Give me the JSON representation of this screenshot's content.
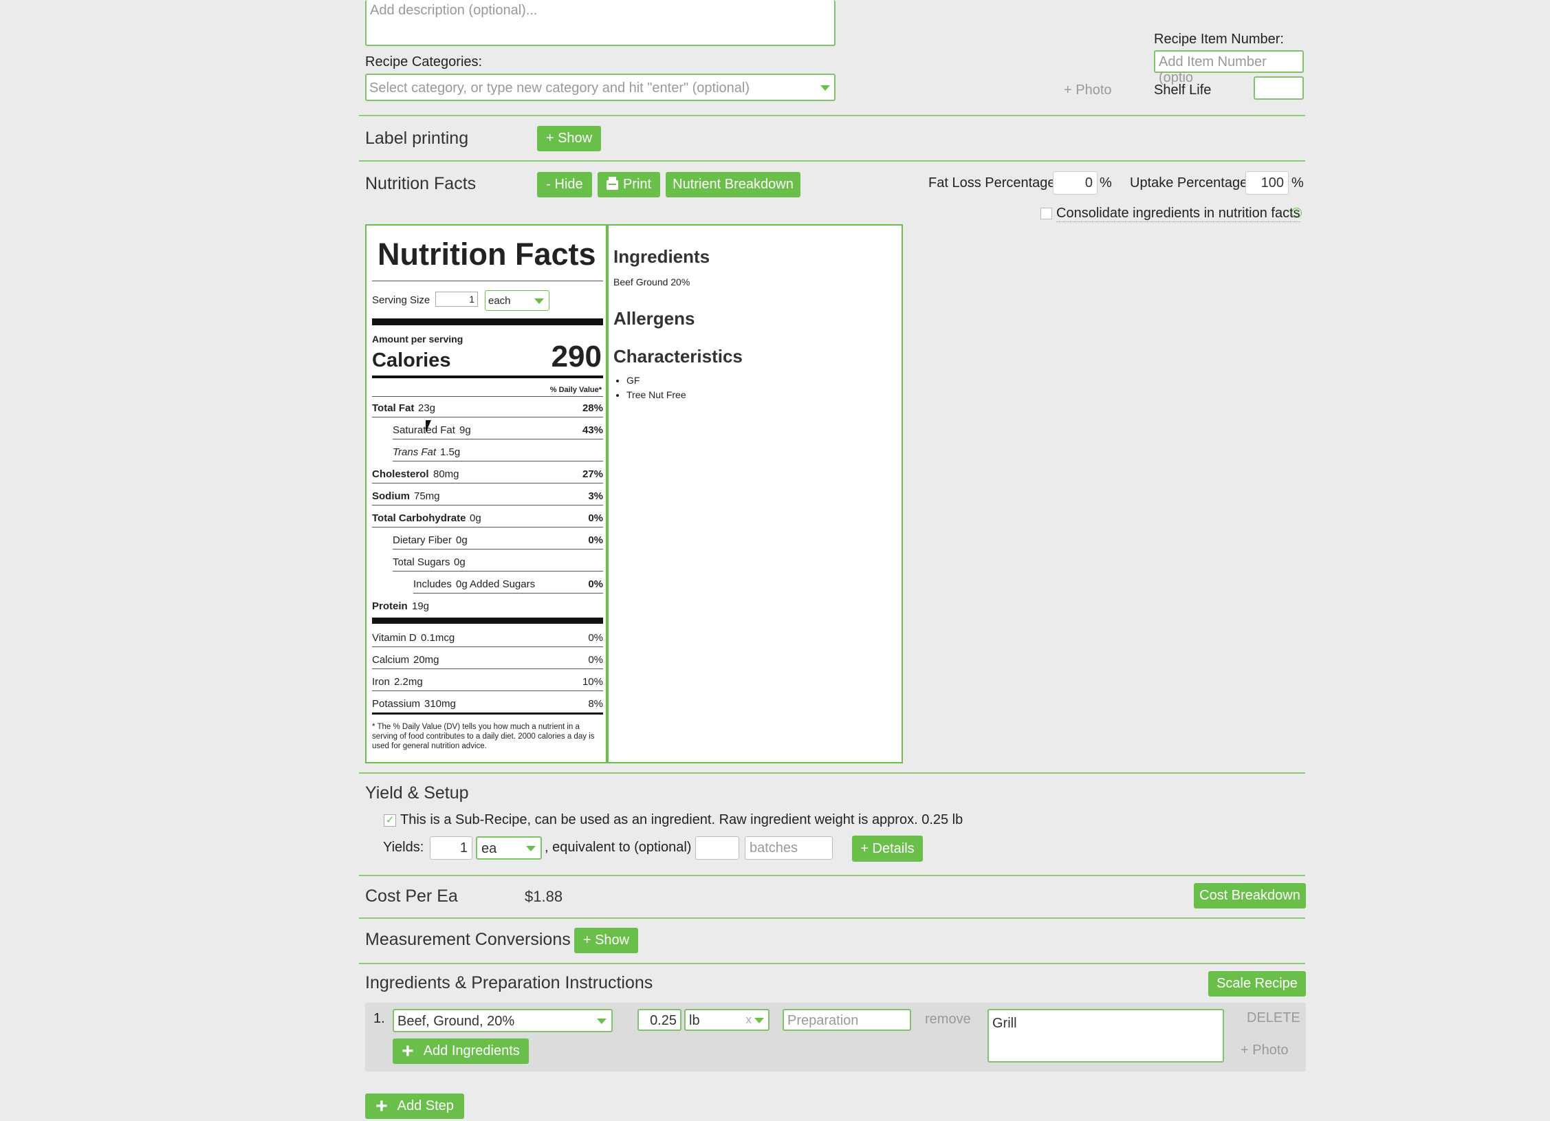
{
  "description": {
    "placeholder": "Add description (optional)..."
  },
  "categories": {
    "label": "Recipe Categories:",
    "placeholder": "Select category, or type new category and hit \"enter\" (optional)"
  },
  "photo_label": "+ Photo",
  "item_number": {
    "label": "Recipe Item Number:",
    "placeholder": "Add Item Number (optio"
  },
  "shelf_life": {
    "label": "Shelf Life",
    "value": ""
  },
  "label_printing": {
    "title": "Label printing",
    "show": "+ Show"
  },
  "nutrition": {
    "title": "Nutrition Facts",
    "hide": "- Hide",
    "print": "Print",
    "breakdown": "Nutrient Breakdown",
    "fat_loss_label": "Fat Loss Percentage",
    "fat_loss_value": "0",
    "uptake_label": "Uptake Percentage",
    "uptake_value": "100",
    "percent": "%",
    "consolidate": "Consolidate ingredients in nutrition facts",
    "help": "?"
  },
  "label": {
    "heading": "Nutrition Facts",
    "serving_size_label": "Serving Size",
    "serving_size_value": "1",
    "serving_unit": "each",
    "amount_per_serving": "Amount per serving",
    "calories_label": "Calories",
    "calories_value": "290",
    "dv_header": "% Daily Value*",
    "rows": [
      {
        "name": "Total Fat",
        "amt": "23g",
        "dv": "28%"
      },
      {
        "name": "Saturated Fat",
        "amt": "9g",
        "dv": "43%"
      },
      {
        "name": "Trans Fat",
        "amt": "1.5g",
        "dv": ""
      },
      {
        "name": "Cholesterol",
        "amt": "80mg",
        "dv": "27%"
      },
      {
        "name": "Sodium",
        "amt": "75mg",
        "dv": "3%"
      },
      {
        "name": "Total Carbohydrate",
        "amt": "0g",
        "dv": "0%"
      },
      {
        "name": "Dietary Fiber",
        "amt": "0g",
        "dv": "0%"
      },
      {
        "name": "Total Sugars",
        "amt": "0g",
        "dv": ""
      },
      {
        "name": "Includes",
        "amt": "0g Added Sugars",
        "dv": "0%"
      },
      {
        "name": "Protein",
        "amt": "19g",
        "dv": ""
      }
    ],
    "micros": [
      {
        "name": "Vitamin D",
        "amt": "0.1mcg",
        "dv": "0%"
      },
      {
        "name": "Calcium",
        "amt": "20mg",
        "dv": "0%"
      },
      {
        "name": "Iron",
        "amt": "2.2mg",
        "dv": "10%"
      },
      {
        "name": "Potassium",
        "amt": "310mg",
        "dv": "8%"
      }
    ],
    "footnote": "* The % Daily Value (DV) tells you how much a nutrient in a serving of food contributes to a daily diet. 2000 calories a day is used for general nutrition advice."
  },
  "info_panel": {
    "ingredients_title": "Ingredients",
    "ingredients_text": "Beef Ground 20%",
    "allergens_title": "Allergens",
    "characteristics_title": "Characteristics",
    "characteristics": [
      "GF",
      "Tree Nut Free"
    ]
  },
  "yield": {
    "title": "Yield & Setup",
    "subrecipe_text": "This is a Sub-Recipe, can be used as an ingredient. Raw ingredient weight is approx. 0.25 lb",
    "yields_label": "Yields:",
    "yields_value": "1",
    "yields_unit": "ea",
    "equivalent_label": ", equivalent to (optional)",
    "equivalent_value": "",
    "batches_placeholder": "batches",
    "details": "+ Details"
  },
  "cost": {
    "title": "Cost Per Ea",
    "value": "$1.88",
    "breakdown": "Cost Breakdown"
  },
  "conversions": {
    "title": "Measurement Conversions",
    "show": "+ Show"
  },
  "ingredients": {
    "title": "Ingredients & Preparation Instructions",
    "scale": "Scale Recipe",
    "step_number": "1.",
    "ingredient": "Beef, Ground, 20%",
    "qty": "0.25",
    "unit": "lb",
    "clear": "x",
    "prep_placeholder": "Preparation",
    "remove": "remove",
    "instructions": "Grill",
    "delete": "DELETE",
    "photo": "+ Photo",
    "add_ingredients": "Add Ingredients",
    "add_step": "Add Step"
  }
}
